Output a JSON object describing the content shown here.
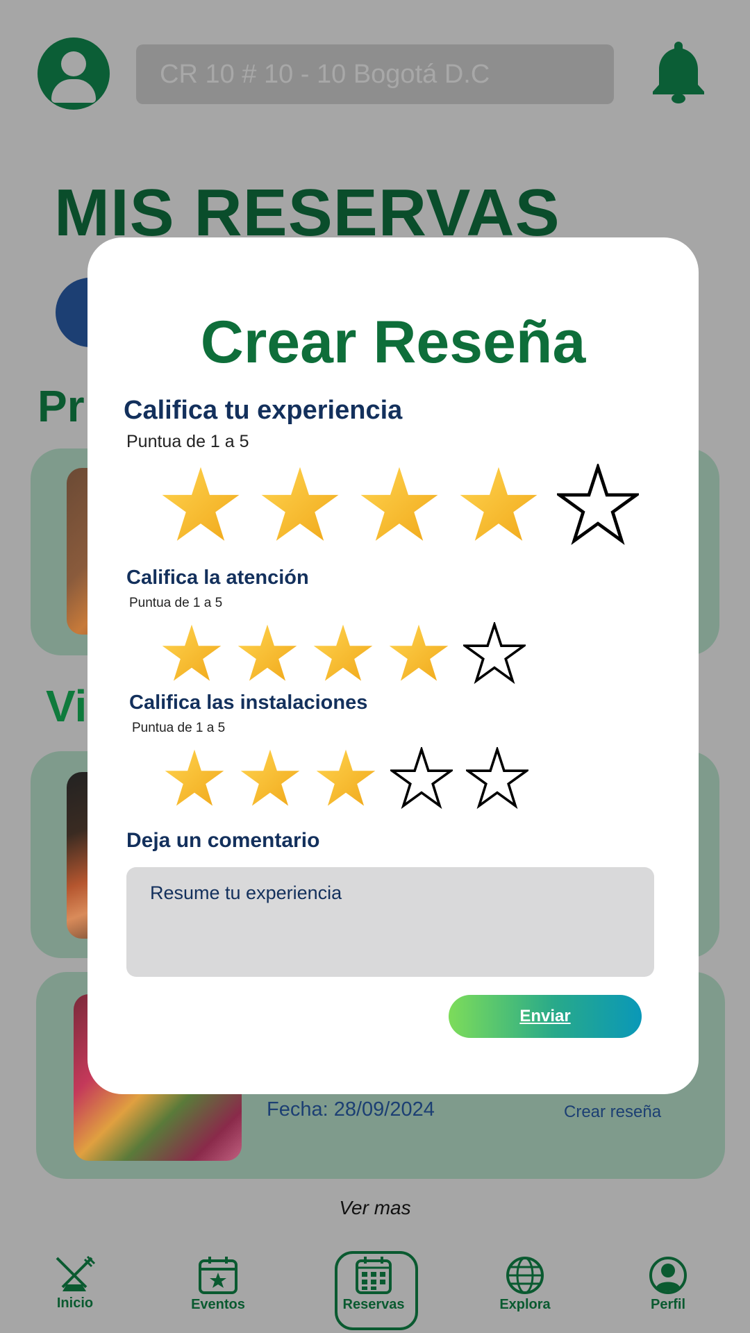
{
  "header": {
    "address": "CR 10 # 10 - 10 Bogotá D.C"
  },
  "page": {
    "title": "MIS RESERVAS",
    "section_fragment_1": "Pr",
    "section_fragment_2": "Vi"
  },
  "reservation_card": {
    "date": "Fecha: 28/09/2024",
    "review_link": "Crear reseña"
  },
  "ver_mas": "Ver mas",
  "bottom_nav": [
    {
      "label": "Inicio",
      "icon": "utensils-icon"
    },
    {
      "label": "Eventos",
      "icon": "calendar-star-icon"
    },
    {
      "label": "Reservas",
      "icon": "calendar-grid-icon",
      "active": true
    },
    {
      "label": "Explora",
      "icon": "globe-icon"
    },
    {
      "label": "Perfil",
      "icon": "user-circle-icon"
    }
  ],
  "modal": {
    "title": "Crear Reseña",
    "ratings": [
      {
        "title": "Califica tu experiencia",
        "subtitle": "Puntua de 1 a 5",
        "value": 4,
        "max": 5
      },
      {
        "title": "Califica la atención",
        "subtitle": "Puntua de 1 a 5",
        "value": 4,
        "max": 5
      },
      {
        "title": "Califica las instalaciones",
        "subtitle": "Puntua de 1 a 5",
        "value": 3,
        "max": 5
      }
    ],
    "comment_label": "Deja un comentario",
    "comment_placeholder": "Resume tu experiencia",
    "submit_label": "Enviar"
  },
  "colors": {
    "brand_green": "#0e6e3a",
    "navy": "#13305c",
    "star_gold": "#f5b828",
    "overlay_gray": "#a6a6a6"
  }
}
